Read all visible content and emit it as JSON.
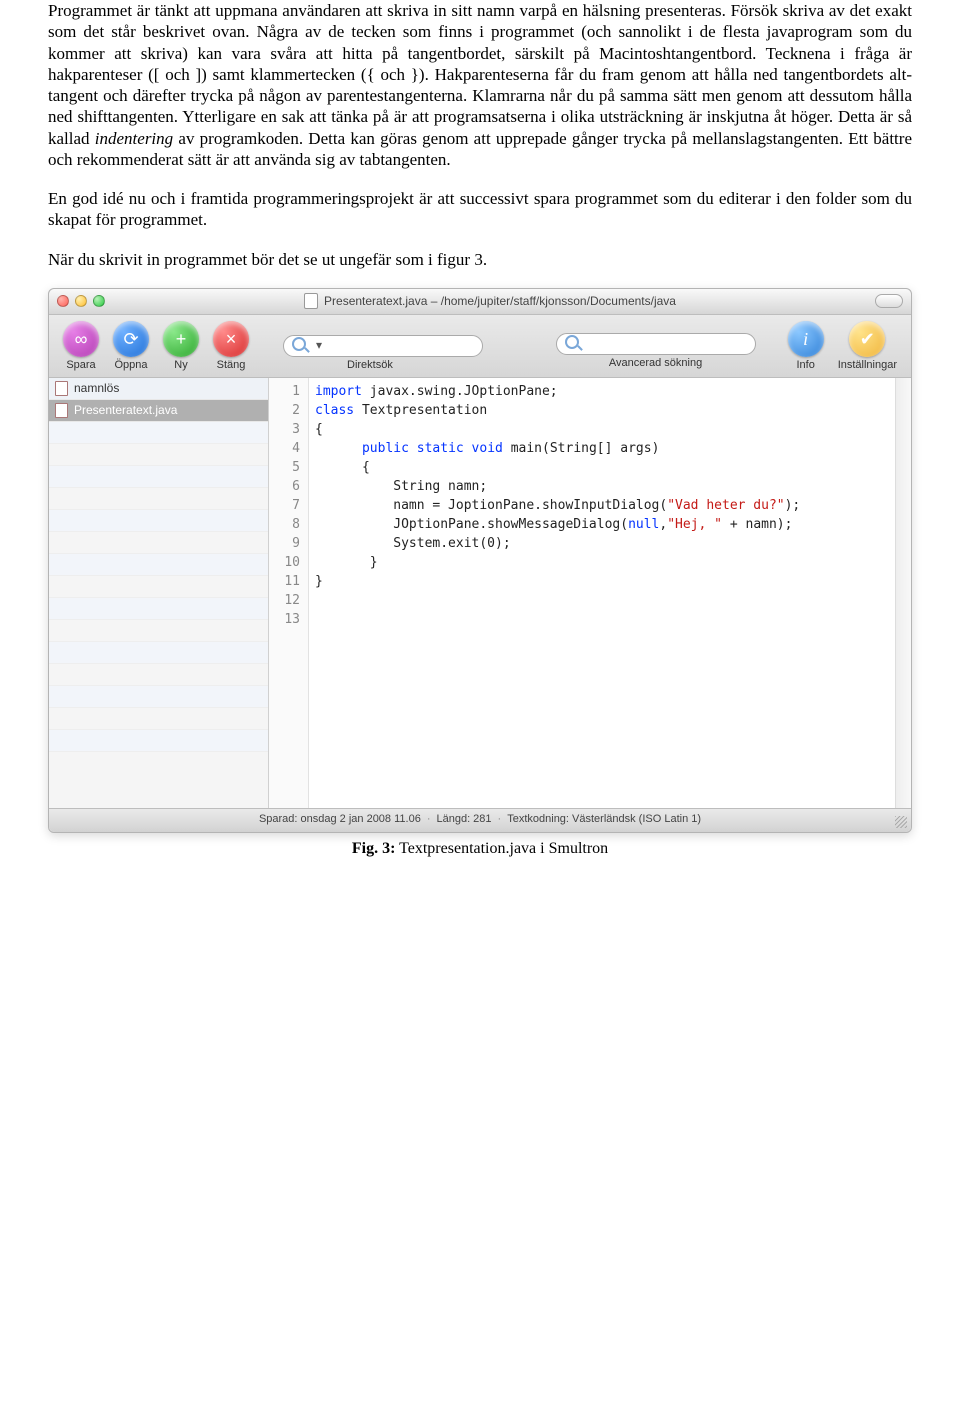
{
  "paragraphs": {
    "p1a": "Programmet är tänkt att uppmana användaren att skriva in sitt namn varpå en hälsning presenteras. Försök skriva av det exakt som det står beskrivet ovan.",
    "p1b": "Några av de tecken som finns i programmet (och sannolikt i de flesta javaprogram som du kommer att skriva) kan vara svåra att hitta på tangentbordet, särskilt på Macintoshtangentbord. Tecknena i fråga är hakparenteser ([ och ]) samt klammertecken ({ och }). Hakparenteserna får du fram genom att hålla ned tangentbordets alt-tangent och därefter trycka på någon av parentestangenterna. Klamrarna når du på samma sätt men genom att dessutom hålla ned shifttangenten. Ytterligare en sak att tänka på är att programsatserna i olika utsträckning är inskjutna åt höger. Detta är så kallad ",
    "p1b_italic": "indentering",
    "p1c": " av programkoden. Detta kan göras genom att upprepade gånger trycka på mellanslagstangenten. Ett bättre och rekommenderat sätt är att använda sig av tabtangenten.",
    "p2": "En god idé nu och i framtida programmeringsprojekt är att successivt spara programmet som du editerar i den folder som du skapat för programmet.",
    "p3": "När du skrivit in programmet bör det se ut ungefär som i figur 3."
  },
  "window": {
    "title": "Presenteratext.java – /home/jupiter/staff/kjonsson/Documents/java",
    "toolbar": {
      "save": "Spara",
      "open": "Öppna",
      "new": "Ny",
      "close": "Stäng",
      "search_placeholder": "",
      "search_label": "Direktsök",
      "adv_search": "Avancerad sökning",
      "info": "Info",
      "prefs": "Inställningar"
    },
    "sidebar": {
      "items": [
        {
          "label": "namnlös",
          "selected": false
        },
        {
          "label": "Presenteratext.java",
          "selected": true
        }
      ]
    },
    "code": {
      "line_count": 13,
      "l1_kw": "import",
      "l1_rest": " javax.swing.JOptionPane;",
      "l2": "",
      "l3_kw": "class",
      "l3_rest": " Textpresentation",
      "l4": "{",
      "l5_pre": "      ",
      "l5_kw1": "public",
      "l5_kw2": " static",
      "l5_kw3": " void",
      "l5_rest": " main(String[] args)",
      "l6": "      {",
      "l7": "          String namn;",
      "l8_pre": "          namn = JoptionPane.showInputDialog(",
      "l8_str": "\"Vad heter du?\"",
      "l8_post": ");",
      "l9_pre": "          JOptionPane.showMessageDialog(",
      "l9_kw": "null",
      "l9_mid": ",",
      "l9_str": "\"Hej, \"",
      "l9_post": " + namn);",
      "l10": "          System.exit(0);",
      "l11": "       }",
      "l12": "}",
      "l13": ""
    },
    "status": {
      "saved": "Sparad: onsdag 2 jan 2008 11.06",
      "length": "Längd: 281",
      "encoding": "Textkodning: Västerländsk (ISO Latin 1)"
    }
  },
  "caption": {
    "bold": "Fig. 3:",
    "rest": " Textpresentation.java i Smultron"
  }
}
